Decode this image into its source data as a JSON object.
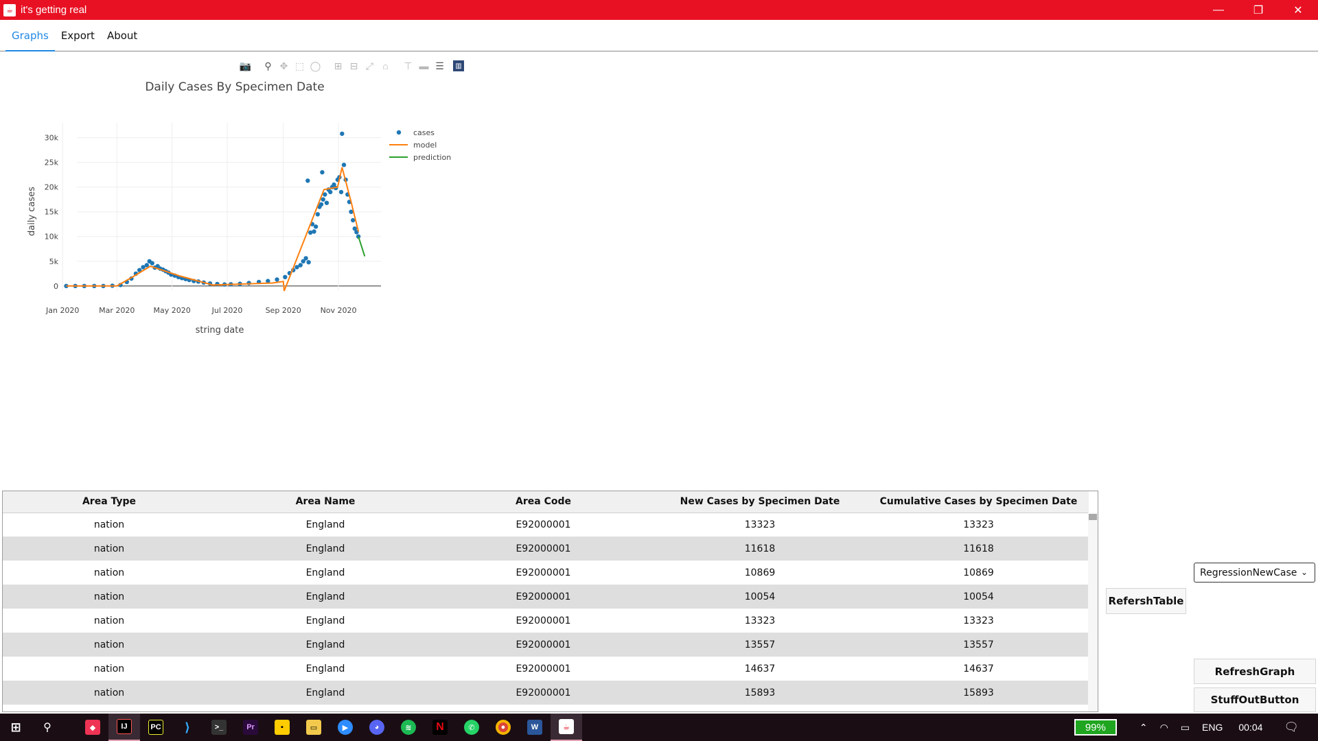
{
  "window": {
    "title": "it's getting real",
    "minimize_glyph": "—",
    "restore_glyph": "❐",
    "close_glyph": "✕"
  },
  "menu": {
    "items": [
      "Graphs",
      "Export",
      "About"
    ],
    "active": "Graphs"
  },
  "modebar": {
    "icons": [
      "camera-icon",
      "zoom-icon",
      "pan-icon",
      "box-select-icon",
      "lasso-icon",
      "zoom-in-icon",
      "zoom-out-icon",
      "autoscale-icon",
      "reset-axes-icon",
      "spike-lines-icon",
      "hover-closest-icon",
      "hover-compare-icon",
      "plotly-logo-icon"
    ]
  },
  "chart_data": {
    "type": "scatter",
    "title": "Daily Cases By Specimen Date",
    "xlabel": "string date",
    "ylabel": "daily cases",
    "x_ticks": [
      "Jan 2020",
      "Mar 2020",
      "May 2020",
      "Jul 2020",
      "Sep 2020",
      "Nov 2020"
    ],
    "y_ticks": [
      "0",
      "5k",
      "10k",
      "15k",
      "20k",
      "25k",
      "30k"
    ],
    "ylim": [
      -1000,
      33000
    ],
    "xlim": [
      "2019-12-25",
      "2020-12-18"
    ],
    "grid": true,
    "legend_position": "top-right",
    "series": [
      {
        "name": "cases",
        "kind": "markers",
        "color": "#1f77b4",
        "points": [
          [
            "2020-01-05",
            0
          ],
          [
            "2020-01-15",
            0
          ],
          [
            "2020-01-25",
            0
          ],
          [
            "2020-02-05",
            0
          ],
          [
            "2020-02-15",
            0
          ],
          [
            "2020-02-25",
            50
          ],
          [
            "2020-03-05",
            200
          ],
          [
            "2020-03-12",
            800
          ],
          [
            "2020-03-17",
            1500
          ],
          [
            "2020-03-22",
            2500
          ],
          [
            "2020-03-26",
            3200
          ],
          [
            "2020-03-30",
            3800
          ],
          [
            "2020-04-03",
            4200
          ],
          [
            "2020-04-06",
            5000
          ],
          [
            "2020-04-09",
            4600
          ],
          [
            "2020-04-12",
            3700
          ],
          [
            "2020-04-15",
            4000
          ],
          [
            "2020-04-18",
            3500
          ],
          [
            "2020-04-21",
            3300
          ],
          [
            "2020-04-24",
            3000
          ],
          [
            "2020-04-27",
            2700
          ],
          [
            "2020-04-30",
            2300
          ],
          [
            "2020-05-04",
            2100
          ],
          [
            "2020-05-08",
            1800
          ],
          [
            "2020-05-12",
            1600
          ],
          [
            "2020-05-16",
            1400
          ],
          [
            "2020-05-20",
            1200
          ],
          [
            "2020-05-25",
            1000
          ],
          [
            "2020-05-30",
            900
          ],
          [
            "2020-06-05",
            700
          ],
          [
            "2020-06-12",
            500
          ],
          [
            "2020-06-20",
            400
          ],
          [
            "2020-06-28",
            300
          ],
          [
            "2020-07-05",
            350
          ],
          [
            "2020-07-15",
            450
          ],
          [
            "2020-07-25",
            600
          ],
          [
            "2020-08-05",
            800
          ],
          [
            "2020-08-15",
            1000
          ],
          [
            "2020-08-25",
            1300
          ],
          [
            "2020-09-03",
            1800
          ],
          [
            "2020-09-08",
            2600
          ],
          [
            "2020-09-12",
            3200
          ],
          [
            "2020-09-16",
            3800
          ],
          [
            "2020-09-20",
            4200
          ],
          [
            "2020-09-23",
            5000
          ],
          [
            "2020-09-26",
            5600
          ],
          [
            "2020-09-29",
            4800
          ],
          [
            "2020-10-01",
            10800
          ],
          [
            "2020-10-03",
            12500
          ],
          [
            "2020-10-05",
            11000
          ],
          [
            "2020-10-07",
            12000
          ],
          [
            "2020-10-09",
            14500
          ],
          [
            "2020-10-11",
            16000
          ],
          [
            "2020-10-13",
            16500
          ],
          [
            "2020-10-15",
            17500
          ],
          [
            "2020-10-17",
            18500
          ],
          [
            "2020-10-19",
            16800
          ],
          [
            "2020-10-21",
            19500
          ],
          [
            "2020-10-23",
            19000
          ],
          [
            "2020-10-25",
            20000
          ],
          [
            "2020-10-27",
            20500
          ],
          [
            "2020-10-29",
            19800
          ],
          [
            "2020-10-31",
            21500
          ],
          [
            "2020-11-02",
            22000
          ],
          [
            "2020-11-04",
            19000
          ],
          [
            "2020-11-05",
            30800
          ],
          [
            "2020-11-07",
            24500
          ],
          [
            "2020-11-09",
            21500
          ],
          [
            "2020-11-11",
            18500
          ],
          [
            "2020-11-13",
            17000
          ],
          [
            "2020-11-15",
            15000
          ],
          [
            "2020-11-17",
            13300
          ],
          [
            "2020-11-19",
            11600
          ],
          [
            "2020-11-21",
            10900
          ],
          [
            "2020-11-23",
            10000
          ],
          [
            "2020-09-28",
            21300
          ],
          [
            "2020-10-14",
            23000
          ]
        ]
      },
      {
        "name": "model",
        "kind": "line",
        "color": "#ff7f0e",
        "points": [
          [
            "2020-01-05",
            0
          ],
          [
            "2020-03-01",
            0
          ],
          [
            "2020-03-20",
            2000
          ],
          [
            "2020-04-07",
            4000
          ],
          [
            "2020-05-10",
            2000
          ],
          [
            "2020-06-15",
            200
          ],
          [
            "2020-08-20",
            600
          ],
          [
            "2020-09-01",
            900
          ],
          [
            "2020-09-02",
            -1000
          ],
          [
            "2020-10-16",
            19500
          ],
          [
            "2020-10-31",
            20000
          ],
          [
            "2020-11-05",
            24000
          ],
          [
            "2020-11-15",
            17000
          ],
          [
            "2020-11-23",
            11000
          ]
        ]
      },
      {
        "name": "prediction",
        "kind": "line",
        "color": "#2ca02c",
        "points": [
          [
            "2020-11-23",
            10000
          ],
          [
            "2020-11-30",
            6000
          ]
        ]
      }
    ]
  },
  "table": {
    "headers": [
      "Area Type",
      "Area Name",
      "Area Code",
      "New Cases by Specimen Date",
      "Cumulative Cases by Specimen Date"
    ],
    "rows": [
      [
        "nation",
        "England",
        "E92000001",
        "13323",
        "13323"
      ],
      [
        "nation",
        "England",
        "E92000001",
        "11618",
        "11618"
      ],
      [
        "nation",
        "England",
        "E92000001",
        "10869",
        "10869"
      ],
      [
        "nation",
        "England",
        "E92000001",
        "10054",
        "10054"
      ],
      [
        "nation",
        "England",
        "E92000001",
        "13323",
        "13323"
      ],
      [
        "nation",
        "England",
        "E92000001",
        "13557",
        "13557"
      ],
      [
        "nation",
        "England",
        "E92000001",
        "14637",
        "14637"
      ],
      [
        "nation",
        "England",
        "E92000001",
        "15893",
        "15893"
      ]
    ]
  },
  "controls": {
    "combo_value": "RegressionNewCase",
    "refresh_table": "RefershTable",
    "refresh_graph": "RefreshGraph",
    "stuff_out": "StuffOutButton"
  },
  "taskbar": {
    "apps": [
      "start-icon",
      "search-icon",
      "affinity-icon",
      "intellij-icon",
      "pycharm-icon",
      "vscode-icon",
      "terminal-icon",
      "premiere-icon",
      "sticky-notes-icon",
      "file-explorer-icon",
      "zoom-icon",
      "discord-icon",
      "spotify-icon",
      "netflix-icon",
      "whatsapp-icon",
      "chrome-icon",
      "word-icon",
      "java-app-icon"
    ],
    "battery": "99%",
    "language": "ENG",
    "time": "00:04"
  }
}
